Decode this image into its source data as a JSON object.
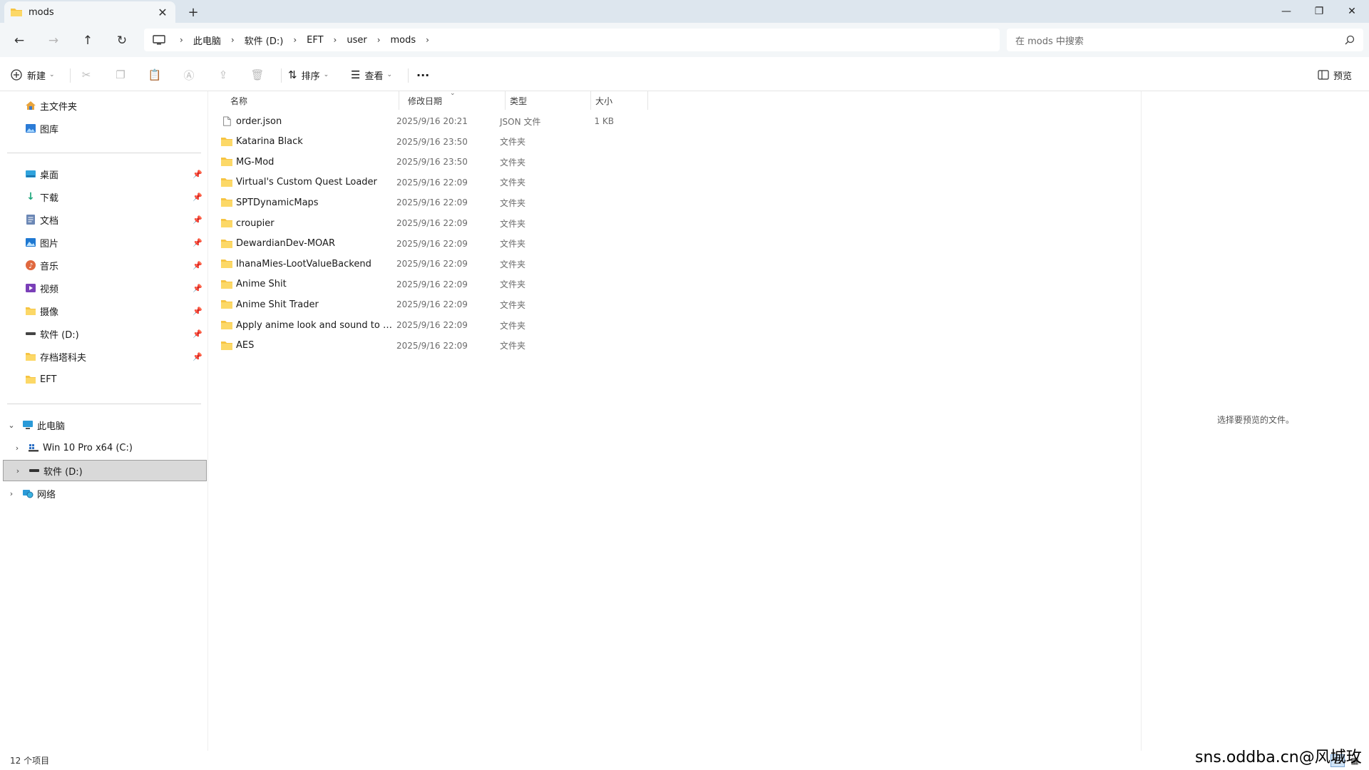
{
  "window": {
    "tab_title": "mods",
    "new_tab_glyph": "+",
    "controls": {
      "minimize": "—",
      "maximize": "❐",
      "close": "✕"
    }
  },
  "navigation": {
    "back_glyph": "←",
    "forward_glyph": "→",
    "up_glyph": "↑",
    "refresh_glyph": "↻",
    "breadcrumbs": [
      "此电脑",
      "软件 (D:)",
      "EFT",
      "user",
      "mods"
    ],
    "search_placeholder": "在 mods 中搜索"
  },
  "toolbar": {
    "new_label": "新建",
    "sort_label": "排序",
    "view_label": "查看",
    "more_label": "···",
    "preview_label": "预览"
  },
  "sidebar": {
    "quick": [
      {
        "label": "主文件夹",
        "icon": "home-icon"
      },
      {
        "label": "图库",
        "icon": "gallery-icon"
      }
    ],
    "pinned": [
      {
        "label": "桌面",
        "icon": "desktop-icon"
      },
      {
        "label": "下载",
        "icon": "download-icon"
      },
      {
        "label": "文档",
        "icon": "document-icon"
      },
      {
        "label": "图片",
        "icon": "pictures-icon"
      },
      {
        "label": "音乐",
        "icon": "music-icon"
      },
      {
        "label": "视频",
        "icon": "video-icon"
      },
      {
        "label": "摄像",
        "icon": "folder-icon"
      },
      {
        "label": "软件 (D:)",
        "icon": "drive-icon"
      },
      {
        "label": "存档塔科夫",
        "icon": "folder-icon"
      },
      {
        "label": "EFT",
        "icon": "folder-icon"
      }
    ],
    "this_pc": "此电脑",
    "drives": [
      "Win 10 Pro x64 (C:)",
      "软件 (D:)"
    ],
    "network": "网络"
  },
  "columns": {
    "name": "名称",
    "date": "修改日期",
    "type": "类型",
    "size": "大小"
  },
  "files": [
    {
      "name": "order.json",
      "date": "2025/9/16 20:21",
      "type": "JSON 文件",
      "size": "1 KB",
      "kind": "file"
    },
    {
      "name": "Katarina Black",
      "date": "2025/9/16 23:50",
      "type": "文件夹",
      "size": "",
      "kind": "folder"
    },
    {
      "name": "MG-Mod",
      "date": "2025/9/16 23:50",
      "type": "文件夹",
      "size": "",
      "kind": "folder"
    },
    {
      "name": "Virtual's Custom Quest Loader",
      "date": "2025/9/16 22:09",
      "type": "文件夹",
      "size": "",
      "kind": "folder"
    },
    {
      "name": "SPTDynamicMaps",
      "date": "2025/9/16 22:09",
      "type": "文件夹",
      "size": "",
      "kind": "folder"
    },
    {
      "name": "croupier",
      "date": "2025/9/16 22:09",
      "type": "文件夹",
      "size": "",
      "kind": "folder"
    },
    {
      "name": "DewardianDev-MOAR",
      "date": "2025/9/16 22:09",
      "type": "文件夹",
      "size": "",
      "kind": "folder"
    },
    {
      "name": "IhanaMies-LootValueBackend",
      "date": "2025/9/16 22:09",
      "type": "文件夹",
      "size": "",
      "kind": "folder"
    },
    {
      "name": "Anime Shit",
      "date": "2025/9/16 22:09",
      "type": "文件夹",
      "size": "",
      "kind": "folder"
    },
    {
      "name": "Anime Shit Trader",
      "date": "2025/9/16 22:09",
      "type": "文件夹",
      "size": "",
      "kind": "folder"
    },
    {
      "name": "Apply anime look and sound to all c...",
      "date": "2025/9/16 22:09",
      "type": "文件夹",
      "size": "",
      "kind": "folder"
    },
    {
      "name": "AES",
      "date": "2025/9/16 22:09",
      "type": "文件夹",
      "size": "",
      "kind": "folder"
    }
  ],
  "preview_message": "选择要预览的文件。",
  "status": {
    "item_count": "12 个项目"
  },
  "watermark": "sns.oddba.cn@风城玫瑰",
  "colors": {
    "folder": "#f6c443",
    "accent": "#0067c0",
    "titlebar": "#dde6ee"
  }
}
